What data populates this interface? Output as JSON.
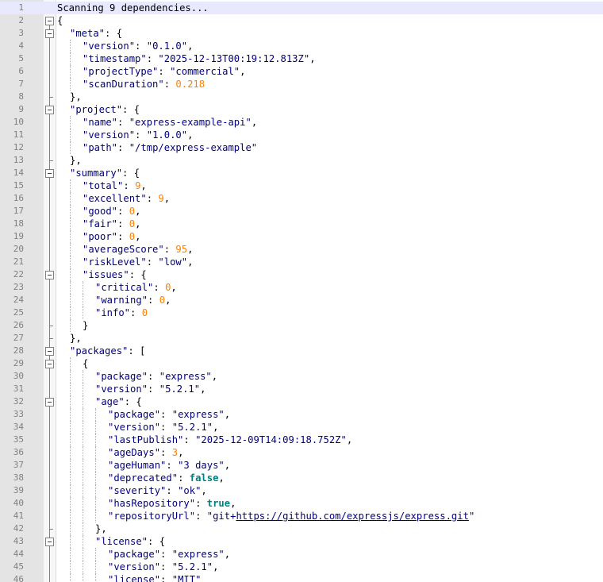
{
  "editor": {
    "title_line": "Scanning 9 dependencies...",
    "current_line": 1,
    "lines": [
      {
        "n": "1",
        "indent": 0,
        "fold": "",
        "tokens": [
          {
            "c": "plain",
            "t": "Scanning 9 dependencies..."
          }
        ]
      },
      {
        "n": "2",
        "indent": 0,
        "fold": "open",
        "tokens": [
          {
            "c": "pun",
            "t": "{"
          }
        ]
      },
      {
        "n": "3",
        "indent": 1,
        "fold": "open",
        "tokens": [
          {
            "c": "key",
            "t": "\"meta\""
          },
          {
            "c": "pun",
            "t": ": {"
          }
        ]
      },
      {
        "n": "4",
        "indent": 2,
        "fold": "line",
        "tokens": [
          {
            "c": "key",
            "t": "\"version\""
          },
          {
            "c": "pun",
            "t": ": "
          },
          {
            "c": "str",
            "t": "\"0.1.0\""
          },
          {
            "c": "pun",
            "t": ","
          }
        ]
      },
      {
        "n": "5",
        "indent": 2,
        "fold": "line",
        "tokens": [
          {
            "c": "key",
            "t": "\"timestamp\""
          },
          {
            "c": "pun",
            "t": ": "
          },
          {
            "c": "str",
            "t": "\"2025-12-13T00:19:12.813Z\""
          },
          {
            "c": "pun",
            "t": ","
          }
        ]
      },
      {
        "n": "6",
        "indent": 2,
        "fold": "line",
        "tokens": [
          {
            "c": "key",
            "t": "\"projectType\""
          },
          {
            "c": "pun",
            "t": ": "
          },
          {
            "c": "str",
            "t": "\"commercial\""
          },
          {
            "c": "pun",
            "t": ","
          }
        ]
      },
      {
        "n": "7",
        "indent": 2,
        "fold": "line",
        "tokens": [
          {
            "c": "key",
            "t": "\"scanDuration\""
          },
          {
            "c": "pun",
            "t": ": "
          },
          {
            "c": "num",
            "t": "0.218"
          }
        ]
      },
      {
        "n": "8",
        "indent": 1,
        "fold": "end",
        "tokens": [
          {
            "c": "pun",
            "t": "},"
          }
        ]
      },
      {
        "n": "9",
        "indent": 1,
        "fold": "open",
        "tokens": [
          {
            "c": "key",
            "t": "\"project\""
          },
          {
            "c": "pun",
            "t": ": {"
          }
        ]
      },
      {
        "n": "10",
        "indent": 2,
        "fold": "line",
        "tokens": [
          {
            "c": "key",
            "t": "\"name\""
          },
          {
            "c": "pun",
            "t": ": "
          },
          {
            "c": "str",
            "t": "\"express-example-api\""
          },
          {
            "c": "pun",
            "t": ","
          }
        ]
      },
      {
        "n": "11",
        "indent": 2,
        "fold": "line",
        "tokens": [
          {
            "c": "key",
            "t": "\"version\""
          },
          {
            "c": "pun",
            "t": ": "
          },
          {
            "c": "str",
            "t": "\"1.0.0\""
          },
          {
            "c": "pun",
            "t": ","
          }
        ]
      },
      {
        "n": "12",
        "indent": 2,
        "fold": "line",
        "tokens": [
          {
            "c": "key",
            "t": "\"path\""
          },
          {
            "c": "pun",
            "t": ": "
          },
          {
            "c": "str",
            "t": "\"/tmp/express-example\""
          }
        ]
      },
      {
        "n": "13",
        "indent": 1,
        "fold": "end",
        "tokens": [
          {
            "c": "pun",
            "t": "},"
          }
        ]
      },
      {
        "n": "14",
        "indent": 1,
        "fold": "open",
        "tokens": [
          {
            "c": "key",
            "t": "\"summary\""
          },
          {
            "c": "pun",
            "t": ": {"
          }
        ]
      },
      {
        "n": "15",
        "indent": 2,
        "fold": "line",
        "tokens": [
          {
            "c": "key",
            "t": "\"total\""
          },
          {
            "c": "pun",
            "t": ": "
          },
          {
            "c": "num",
            "t": "9"
          },
          {
            "c": "pun",
            "t": ","
          }
        ]
      },
      {
        "n": "16",
        "indent": 2,
        "fold": "line",
        "tokens": [
          {
            "c": "key",
            "t": "\"excellent\""
          },
          {
            "c": "pun",
            "t": ": "
          },
          {
            "c": "num",
            "t": "9"
          },
          {
            "c": "pun",
            "t": ","
          }
        ]
      },
      {
        "n": "17",
        "indent": 2,
        "fold": "line",
        "tokens": [
          {
            "c": "key",
            "t": "\"good\""
          },
          {
            "c": "pun",
            "t": ": "
          },
          {
            "c": "num",
            "t": "0"
          },
          {
            "c": "pun",
            "t": ","
          }
        ]
      },
      {
        "n": "18",
        "indent": 2,
        "fold": "line",
        "tokens": [
          {
            "c": "key",
            "t": "\"fair\""
          },
          {
            "c": "pun",
            "t": ": "
          },
          {
            "c": "num",
            "t": "0"
          },
          {
            "c": "pun",
            "t": ","
          }
        ]
      },
      {
        "n": "19",
        "indent": 2,
        "fold": "line",
        "tokens": [
          {
            "c": "key",
            "t": "\"poor\""
          },
          {
            "c": "pun",
            "t": ": "
          },
          {
            "c": "num",
            "t": "0"
          },
          {
            "c": "pun",
            "t": ","
          }
        ]
      },
      {
        "n": "20",
        "indent": 2,
        "fold": "line",
        "tokens": [
          {
            "c": "key",
            "t": "\"averageScore\""
          },
          {
            "c": "pun",
            "t": ": "
          },
          {
            "c": "num",
            "t": "95"
          },
          {
            "c": "pun",
            "t": ","
          }
        ]
      },
      {
        "n": "21",
        "indent": 2,
        "fold": "line",
        "tokens": [
          {
            "c": "key",
            "t": "\"riskLevel\""
          },
          {
            "c": "pun",
            "t": ": "
          },
          {
            "c": "str",
            "t": "\"low\""
          },
          {
            "c": "pun",
            "t": ","
          }
        ]
      },
      {
        "n": "22",
        "indent": 2,
        "fold": "open",
        "tokens": [
          {
            "c": "key",
            "t": "\"issues\""
          },
          {
            "c": "pun",
            "t": ": {"
          }
        ]
      },
      {
        "n": "23",
        "indent": 3,
        "fold": "line",
        "tokens": [
          {
            "c": "key",
            "t": "\"critical\""
          },
          {
            "c": "pun",
            "t": ": "
          },
          {
            "c": "num",
            "t": "0"
          },
          {
            "c": "pun",
            "t": ","
          }
        ]
      },
      {
        "n": "24",
        "indent": 3,
        "fold": "line",
        "tokens": [
          {
            "c": "key",
            "t": "\"warning\""
          },
          {
            "c": "pun",
            "t": ": "
          },
          {
            "c": "num",
            "t": "0"
          },
          {
            "c": "pun",
            "t": ","
          }
        ]
      },
      {
        "n": "25",
        "indent": 3,
        "fold": "line",
        "tokens": [
          {
            "c": "key",
            "t": "\"info\""
          },
          {
            "c": "pun",
            "t": ": "
          },
          {
            "c": "num",
            "t": "0"
          }
        ]
      },
      {
        "n": "26",
        "indent": 2,
        "fold": "end",
        "tokens": [
          {
            "c": "pun",
            "t": "}"
          }
        ]
      },
      {
        "n": "27",
        "indent": 1,
        "fold": "end",
        "tokens": [
          {
            "c": "pun",
            "t": "},"
          }
        ]
      },
      {
        "n": "28",
        "indent": 1,
        "fold": "open",
        "tokens": [
          {
            "c": "key",
            "t": "\"packages\""
          },
          {
            "c": "pun",
            "t": ": ["
          }
        ]
      },
      {
        "n": "29",
        "indent": 2,
        "fold": "open",
        "tokens": [
          {
            "c": "pun",
            "t": "{"
          }
        ]
      },
      {
        "n": "30",
        "indent": 3,
        "fold": "line",
        "tokens": [
          {
            "c": "key",
            "t": "\"package\""
          },
          {
            "c": "pun",
            "t": ": "
          },
          {
            "c": "str",
            "t": "\"express\""
          },
          {
            "c": "pun",
            "t": ","
          }
        ]
      },
      {
        "n": "31",
        "indent": 3,
        "fold": "line",
        "tokens": [
          {
            "c": "key",
            "t": "\"version\""
          },
          {
            "c": "pun",
            "t": ": "
          },
          {
            "c": "str",
            "t": "\"5.2.1\""
          },
          {
            "c": "pun",
            "t": ","
          }
        ]
      },
      {
        "n": "32",
        "indent": 3,
        "fold": "open",
        "tokens": [
          {
            "c": "key",
            "t": "\"age\""
          },
          {
            "c": "pun",
            "t": ": {"
          }
        ]
      },
      {
        "n": "33",
        "indent": 4,
        "fold": "line",
        "tokens": [
          {
            "c": "key",
            "t": "\"package\""
          },
          {
            "c": "pun",
            "t": ": "
          },
          {
            "c": "str",
            "t": "\"express\""
          },
          {
            "c": "pun",
            "t": ","
          }
        ]
      },
      {
        "n": "34",
        "indent": 4,
        "fold": "line",
        "tokens": [
          {
            "c": "key",
            "t": "\"version\""
          },
          {
            "c": "pun",
            "t": ": "
          },
          {
            "c": "str",
            "t": "\"5.2.1\""
          },
          {
            "c": "pun",
            "t": ","
          }
        ]
      },
      {
        "n": "35",
        "indent": 4,
        "fold": "line",
        "tokens": [
          {
            "c": "key",
            "t": "\"lastPublish\""
          },
          {
            "c": "pun",
            "t": ": "
          },
          {
            "c": "str",
            "t": "\"2025-12-09T14:09:18.752Z\""
          },
          {
            "c": "pun",
            "t": ","
          }
        ]
      },
      {
        "n": "36",
        "indent": 4,
        "fold": "line",
        "tokens": [
          {
            "c": "key",
            "t": "\"ageDays\""
          },
          {
            "c": "pun",
            "t": ": "
          },
          {
            "c": "num",
            "t": "3"
          },
          {
            "c": "pun",
            "t": ","
          }
        ]
      },
      {
        "n": "37",
        "indent": 4,
        "fold": "line",
        "tokens": [
          {
            "c": "key",
            "t": "\"ageHuman\""
          },
          {
            "c": "pun",
            "t": ": "
          },
          {
            "c": "str",
            "t": "\"3 days\""
          },
          {
            "c": "pun",
            "t": ","
          }
        ]
      },
      {
        "n": "38",
        "indent": 4,
        "fold": "line",
        "tokens": [
          {
            "c": "key",
            "t": "\"deprecated\""
          },
          {
            "c": "pun",
            "t": ": "
          },
          {
            "c": "bool",
            "t": "false"
          },
          {
            "c": "pun",
            "t": ","
          }
        ]
      },
      {
        "n": "39",
        "indent": 4,
        "fold": "line",
        "tokens": [
          {
            "c": "key",
            "t": "\"severity\""
          },
          {
            "c": "pun",
            "t": ": "
          },
          {
            "c": "str",
            "t": "\"ok\""
          },
          {
            "c": "pun",
            "t": ","
          }
        ]
      },
      {
        "n": "40",
        "indent": 4,
        "fold": "line",
        "tokens": [
          {
            "c": "key",
            "t": "\"hasRepository\""
          },
          {
            "c": "pun",
            "t": ": "
          },
          {
            "c": "bool",
            "t": "true"
          },
          {
            "c": "pun",
            "t": ","
          }
        ]
      },
      {
        "n": "41",
        "indent": 4,
        "fold": "line",
        "tokens": [
          {
            "c": "key",
            "t": "\"repositoryUrl\""
          },
          {
            "c": "pun",
            "t": ": "
          },
          {
            "c": "str",
            "t": "\"git+"
          },
          {
            "c": "link",
            "t": "https://github.com/expressjs/express.git"
          },
          {
            "c": "str",
            "t": "\""
          }
        ]
      },
      {
        "n": "42",
        "indent": 3,
        "fold": "end",
        "tokens": [
          {
            "c": "pun",
            "t": "},"
          }
        ]
      },
      {
        "n": "43",
        "indent": 3,
        "fold": "open",
        "tokens": [
          {
            "c": "key",
            "t": "\"license\""
          },
          {
            "c": "pun",
            "t": ": {"
          }
        ]
      },
      {
        "n": "44",
        "indent": 4,
        "fold": "line",
        "tokens": [
          {
            "c": "key",
            "t": "\"package\""
          },
          {
            "c": "pun",
            "t": ": "
          },
          {
            "c": "str",
            "t": "\"express\""
          },
          {
            "c": "pun",
            "t": ","
          }
        ]
      },
      {
        "n": "45",
        "indent": 4,
        "fold": "line",
        "tokens": [
          {
            "c": "key",
            "t": "\"version\""
          },
          {
            "c": "pun",
            "t": ": "
          },
          {
            "c": "str",
            "t": "\"5.2.1\""
          },
          {
            "c": "pun",
            "t": ","
          }
        ]
      },
      {
        "n": "46",
        "indent": 4,
        "fold": "line",
        "tokens": [
          {
            "c": "key",
            "t": "\"license\""
          },
          {
            "c": "pun",
            "t": ": "
          },
          {
            "c": "str",
            "t": "\"MIT\""
          }
        ]
      }
    ]
  }
}
